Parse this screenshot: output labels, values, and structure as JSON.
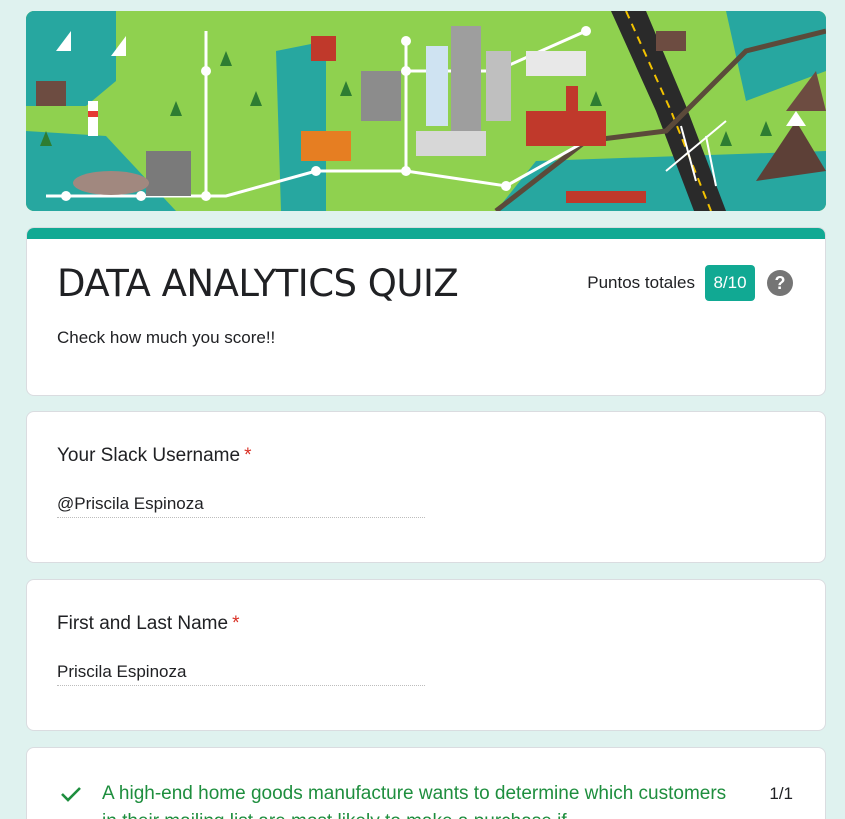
{
  "banner": {
    "name": "city-map-illustration"
  },
  "form": {
    "title": "DATA ANALYTICS QUIZ",
    "description": "Check how much you score!!",
    "score_label": "Puntos totales",
    "score_value": "8/10",
    "accent_color": "#11a993"
  },
  "questions": [
    {
      "title": "Your Slack Username",
      "required_mark": "*",
      "answer": "@Priscila Espinoza"
    },
    {
      "title": "First and Last Name",
      "required_mark": "*",
      "answer": "Priscila Espinoza"
    },
    {
      "title": "A high-end home goods manufacture wants to determine which customers in their mailing list are most likely to make a purchase if",
      "score": "1/1",
      "status_icon": "check-icon"
    }
  ]
}
